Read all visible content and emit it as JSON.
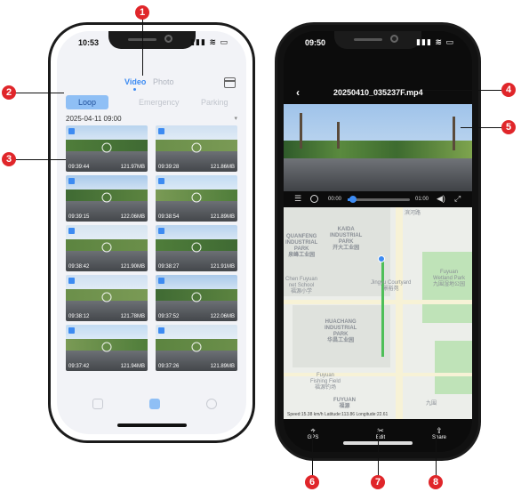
{
  "left_phone": {
    "status_time": "10:53",
    "tabs": {
      "video": "Video",
      "photo": "Photo"
    },
    "subtabs": {
      "loop": "Loop",
      "emergency": "Emergency",
      "parking": "Parking"
    },
    "date_header": "2025-04-11 09:00",
    "thumbnails": [
      {
        "time": "09:39:44",
        "size": "121.97MB"
      },
      {
        "time": "09:39:28",
        "size": "121.86MB"
      },
      {
        "time": "09:39:15",
        "size": "122.06MB"
      },
      {
        "time": "09:38:54",
        "size": "121.89MB"
      },
      {
        "time": "09:38:42",
        "size": "121.90MB"
      },
      {
        "time": "09:38:27",
        "size": "121.91MB"
      },
      {
        "time": "09:38:12",
        "size": "121.78MB"
      },
      {
        "time": "09:37:52",
        "size": "122.06MB"
      },
      {
        "time": "09:37:42",
        "size": "121.94MB"
      },
      {
        "time": "09:37:26",
        "size": "121.89MB"
      }
    ]
  },
  "right_phone": {
    "status_time": "09:50",
    "file_name": "20250410_035237F.mp4",
    "player": {
      "current": "00:00",
      "total": "01:00",
      "progress_percent": 6
    },
    "map_labels": {
      "kaida": "KAIDA\nINDUSTRIAL\nPARK\n开大工业园",
      "quanfeng": "QUANFENG\nINDUSTRIAL\nPARK\n泉峰工业园",
      "huachang": "HUACHANG\nINDUSTRIAL\nPARK\n华昌工业园",
      "fuyuan": "FUYUAN\n福源",
      "jingyu": "Jingyu Courtyard\n景裕苑",
      "fuyuan_school": "Chen Fuyuan\nnet School\n福源小学",
      "wetland": "Fuyuan\nWetland Park\n九围湿地公园",
      "fishing": "Fuyuan\nFishing Field\n福源钓场",
      "binhe": "滨河路",
      "jiuwei": "九围"
    },
    "map_footer": "Speed:15.38 km/h Latitude:113.86 Longitude:22.61",
    "actions": {
      "gps": "GPS",
      "edit": "Edit",
      "share": "Share"
    }
  },
  "callouts": [
    "1",
    "2",
    "3",
    "4",
    "5",
    "6",
    "7",
    "8"
  ]
}
